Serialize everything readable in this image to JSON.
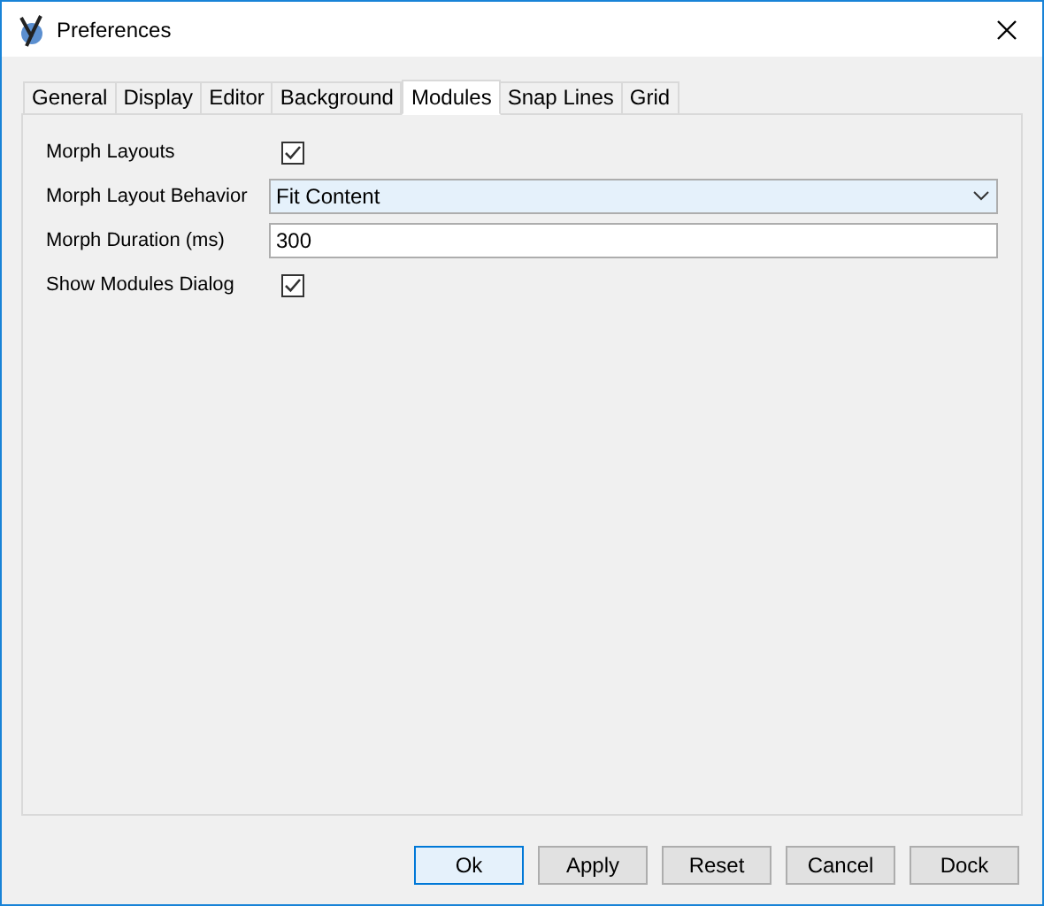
{
  "window": {
    "title": "Preferences"
  },
  "tabs": [
    {
      "label": "General",
      "selected": false
    },
    {
      "label": "Display",
      "selected": false
    },
    {
      "label": "Editor",
      "selected": false
    },
    {
      "label": "Background",
      "selected": false
    },
    {
      "label": "Modules",
      "selected": true
    },
    {
      "label": "Snap Lines",
      "selected": false
    },
    {
      "label": "Grid",
      "selected": false
    }
  ],
  "settings": [
    {
      "kind": "checkbox",
      "label": "Morph Layouts",
      "checked": true
    },
    {
      "kind": "dropdown",
      "label": "Morph Layout Behavior",
      "value": "Fit Content"
    },
    {
      "kind": "text",
      "label": "Morph Duration (ms)",
      "value": "300"
    },
    {
      "kind": "checkbox",
      "label": "Show Modules Dialog",
      "checked": true
    }
  ],
  "buttons": [
    {
      "label": "Ok",
      "default": true
    },
    {
      "label": "Apply",
      "default": false
    },
    {
      "label": "Reset",
      "default": false
    },
    {
      "label": "Cancel",
      "default": false
    },
    {
      "label": "Dock",
      "default": false
    }
  ]
}
